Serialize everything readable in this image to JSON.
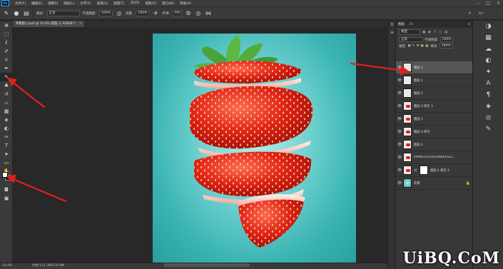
{
  "menubar": {
    "items": [
      "文件(F)",
      "编辑(E)",
      "图像(I)",
      "图层(L)",
      "文字(Y)",
      "选择(S)",
      "滤镜(T)",
      "3D(D)",
      "视图(V)",
      "窗口(W)",
      "帮助(H)"
    ],
    "logo": "Ps"
  },
  "options": {
    "mode_label": "模式:",
    "mode_value": "正常",
    "opacity_label": "不透明度:",
    "opacity_value": "100%",
    "flow_label": "流量:",
    "flow_value": "100%",
    "smooth_label": "平滑:",
    "smooth_value": "0%"
  },
  "document": {
    "tab_title": "草莓图.(.psd) @ 14.4% (图层 3, RGB/8) *",
    "close": "×"
  },
  "status": {
    "zoom": "14.4%",
    "doc_size": "文档:111.3M/376.9M"
  },
  "layers_panel": {
    "tab_active": "图层",
    "tab_inactive": "3D",
    "filter_label": "类型",
    "blend_mode": "正常",
    "opacity_label": "不透明度:",
    "opacity_value": "100%",
    "lock_label": "锁定:",
    "fill_label": "填充:",
    "fill_value": "100%",
    "layers": [
      {
        "name": "图层 3",
        "selected": true,
        "thumb": "plain"
      },
      {
        "name": "图层 1",
        "selected": false,
        "thumb": "plain"
      },
      {
        "name": "图层 2",
        "selected": false,
        "thumb": "plain"
      },
      {
        "name": "图层 4 拷贝 3",
        "selected": false,
        "thumb": "red"
      },
      {
        "name": "图层 2",
        "selected": false,
        "thumb": "red"
      },
      {
        "name": "图层 4 拷贝",
        "selected": false,
        "thumb": "red"
      },
      {
        "name": "图层 4",
        "selected": false,
        "thumb": "red"
      },
      {
        "name": "0effde221c003d6601a22...",
        "selected": false,
        "thumb": "red"
      },
      {
        "name": "图层 4 拷贝 2",
        "selected": false,
        "thumb": "mask"
      },
      {
        "name": "背景",
        "selected": false,
        "thumb": "teal"
      }
    ]
  },
  "watermark": "UiBQ.CoM",
  "colors": {
    "annotation": "#e02020",
    "artboard_center": "#b6eeed",
    "artboard_edge": "#2a9ea1"
  }
}
